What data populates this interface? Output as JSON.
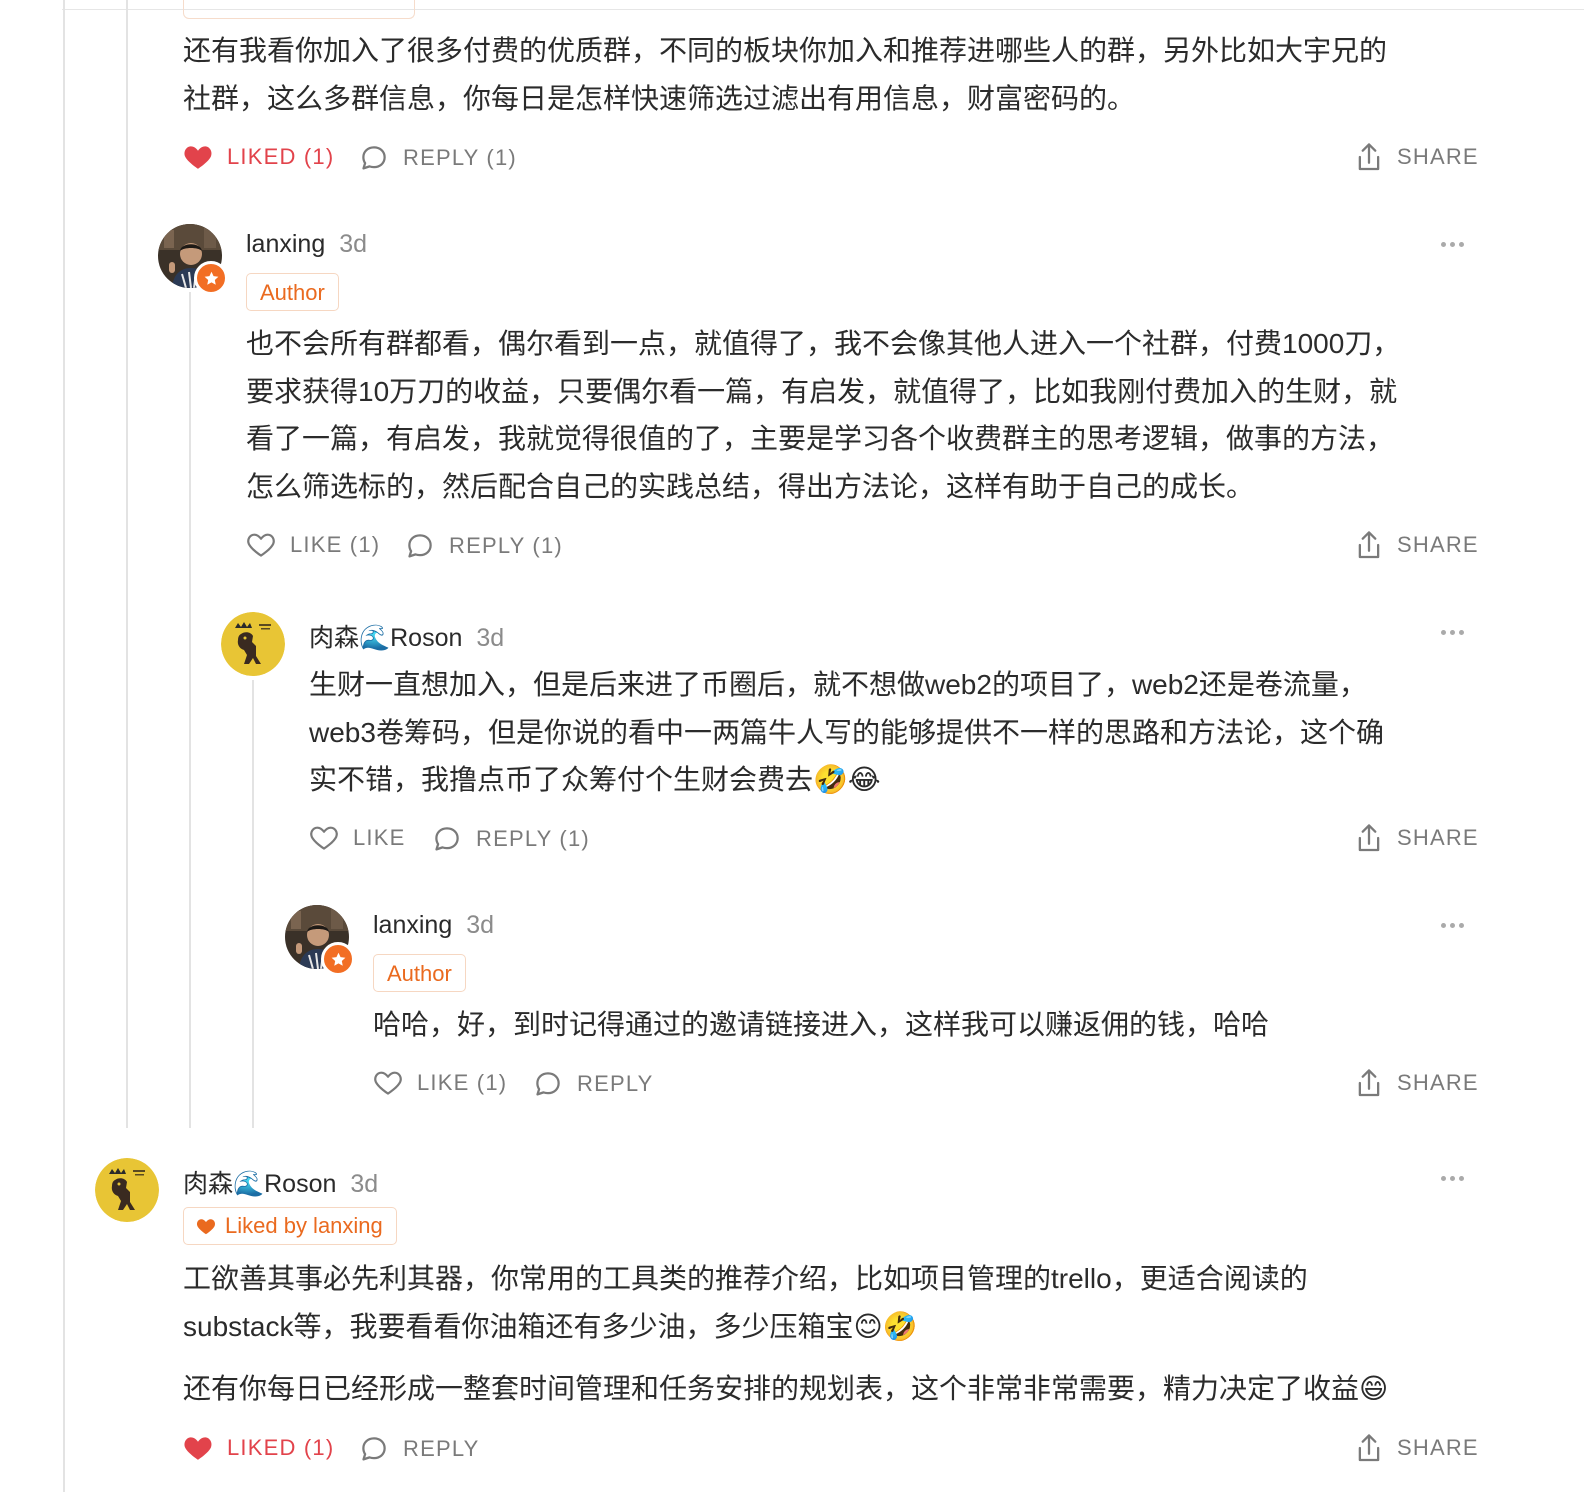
{
  "colors": {
    "accent_orange": "#ea6a1f",
    "liked_red": "#e2434b",
    "muted_text": "#7a7a7a",
    "thread_line": "#e3e3e3"
  },
  "comments": [
    {
      "id": "c1",
      "body": [
        "还有我看你加入了很多付费的优质群，不同的板块你加入和推荐进哪些人的群，另外比如大宇兄的",
        "社群，这么多群信息，你每日是怎样快速筛选过滤出有用信息，财富密码的。"
      ],
      "like_label": "LIKED (1)",
      "like_icon": "heart-filled-icon",
      "reply_label": "REPLY (1)",
      "share_label": "SHARE"
    },
    {
      "id": "c2",
      "author": "lanxing",
      "time": "3d",
      "badge": "Author",
      "avatar_icon": "avatar-photo",
      "body": [
        "也不会所有群都看，偶尔看到一点，就值得了，我不会像其他人进入一个社群，付费1000刀，",
        "要求获得10万刀的收益，只要偶尔看一篇，有启发，就值得了，比如我刚付费加入的生财，就",
        "看了一篇，有启发，我就觉得很值的了，主要是学习各个收费群主的思考逻辑，做事的方法，",
        "怎么筛选标的，然后配合自己的实践总结，得出方法论，这样有助于自己的成长。"
      ],
      "like_label": "LIKE (1)",
      "like_icon": "heart-outline-icon",
      "reply_label": "REPLY (1)",
      "share_label": "SHARE"
    },
    {
      "id": "c3",
      "author": "肉森🌊Roson",
      "time": "3d",
      "avatar_icon": "avatar-dinosaur",
      "body": [
        "生财一直想加入，但是后来进了币圈后，就不想做web2的项目了，web2还是卷流量，",
        "web3卷筹码，但是你说的看中一两篇牛人写的能够提供不一样的思路和方法论，这个确",
        "实不错，我撸点币了众筹付个生财会费去🤣😂"
      ],
      "like_label": "LIKE",
      "like_icon": "heart-outline-icon",
      "reply_label": "REPLY (1)",
      "share_label": "SHARE"
    },
    {
      "id": "c4",
      "author": "lanxing",
      "time": "3d",
      "badge": "Author",
      "avatar_icon": "avatar-photo",
      "body": [
        "哈哈，好，到时记得通过的邀请链接进入，这样我可以赚返佣的钱，哈哈"
      ],
      "like_label": "LIKE (1)",
      "like_icon": "heart-outline-icon",
      "reply_label": "REPLY",
      "share_label": "SHARE"
    },
    {
      "id": "c5",
      "author": "肉森🌊Roson",
      "time": "3d",
      "badge": "Liked by lanxing",
      "avatar_icon": "avatar-dinosaur",
      "body": [
        "工欲善其事必先利其器，你常用的工具类的推荐介绍，比如项目管理的trello，更适合阅读的",
        "substack等，我要看看你油箱还有多少油，多少压箱宝😊🤣"
      ],
      "body2": "还有你每日已经形成一整套时间管理和任务安排的规划表，这个非常非常需要，精力决定了收益😄",
      "like_label": "LIKED (1)",
      "like_icon": "heart-filled-icon",
      "reply_label": "REPLY",
      "share_label": "SHARE"
    }
  ]
}
